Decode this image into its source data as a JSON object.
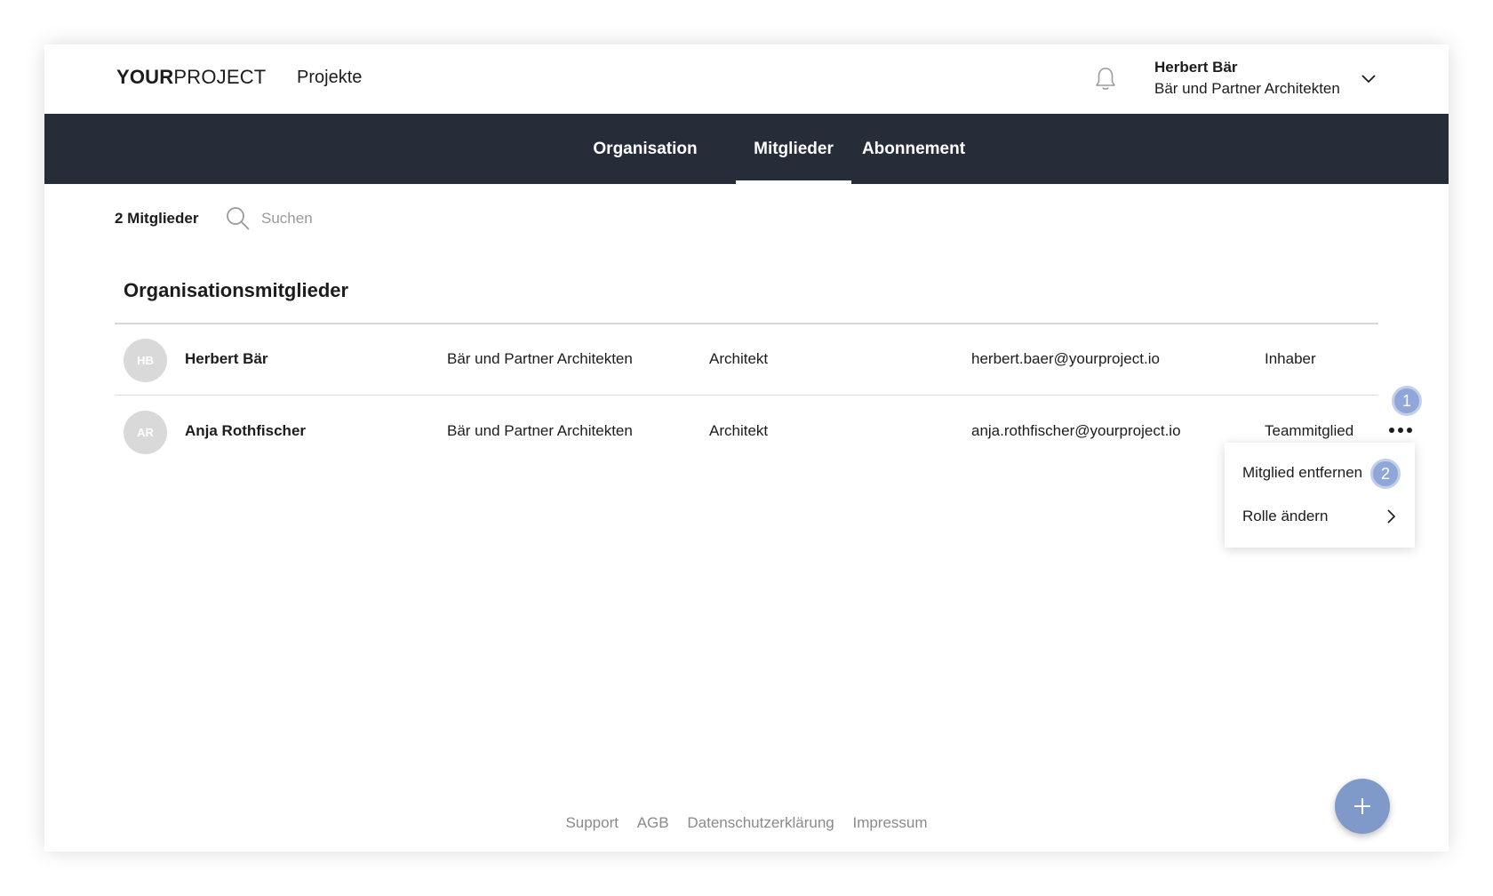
{
  "header": {
    "logo_bold": "YOUR",
    "logo_light": "PROJECT",
    "nav_projects": "Projekte",
    "user_name": "Herbert Bär",
    "user_org": "Bär und Partner Architekten"
  },
  "tabs": [
    {
      "label": "Organisation",
      "active": false
    },
    {
      "label": "Mitglieder",
      "active": true
    },
    {
      "label": "Abonnement",
      "active": false
    }
  ],
  "toolbar": {
    "member_count": "2 Mitglieder",
    "search_placeholder": "Suchen"
  },
  "section": {
    "title": "Organisationsmitglieder"
  },
  "members": [
    {
      "initials": "HB",
      "name": "Herbert Bär",
      "company": "Bär und Partner Architekten",
      "profession": "Architekt",
      "email": "herbert.baer@yourproject.io",
      "role": "Inhaber"
    },
    {
      "initials": "AR",
      "name": "Anja Rothfischer",
      "company": "Bär und Partner Architekten",
      "profession": "Architekt",
      "email": "anja.rothfischer@yourproject.io",
      "role": "Teammitglied"
    }
  ],
  "context_menu": {
    "items": [
      {
        "label": "Mitglied entfernen"
      },
      {
        "label": "Rolle ändern"
      }
    ]
  },
  "annotations": {
    "step1": "1",
    "step2": "2"
  },
  "footer": {
    "links": [
      "Support",
      "AGB",
      "Datenschutzerklärung",
      "Impressum"
    ]
  },
  "colors": {
    "tabbar_bg": "#262d38",
    "accent": "#7f9ac9",
    "badge": "#8fa6d8"
  }
}
